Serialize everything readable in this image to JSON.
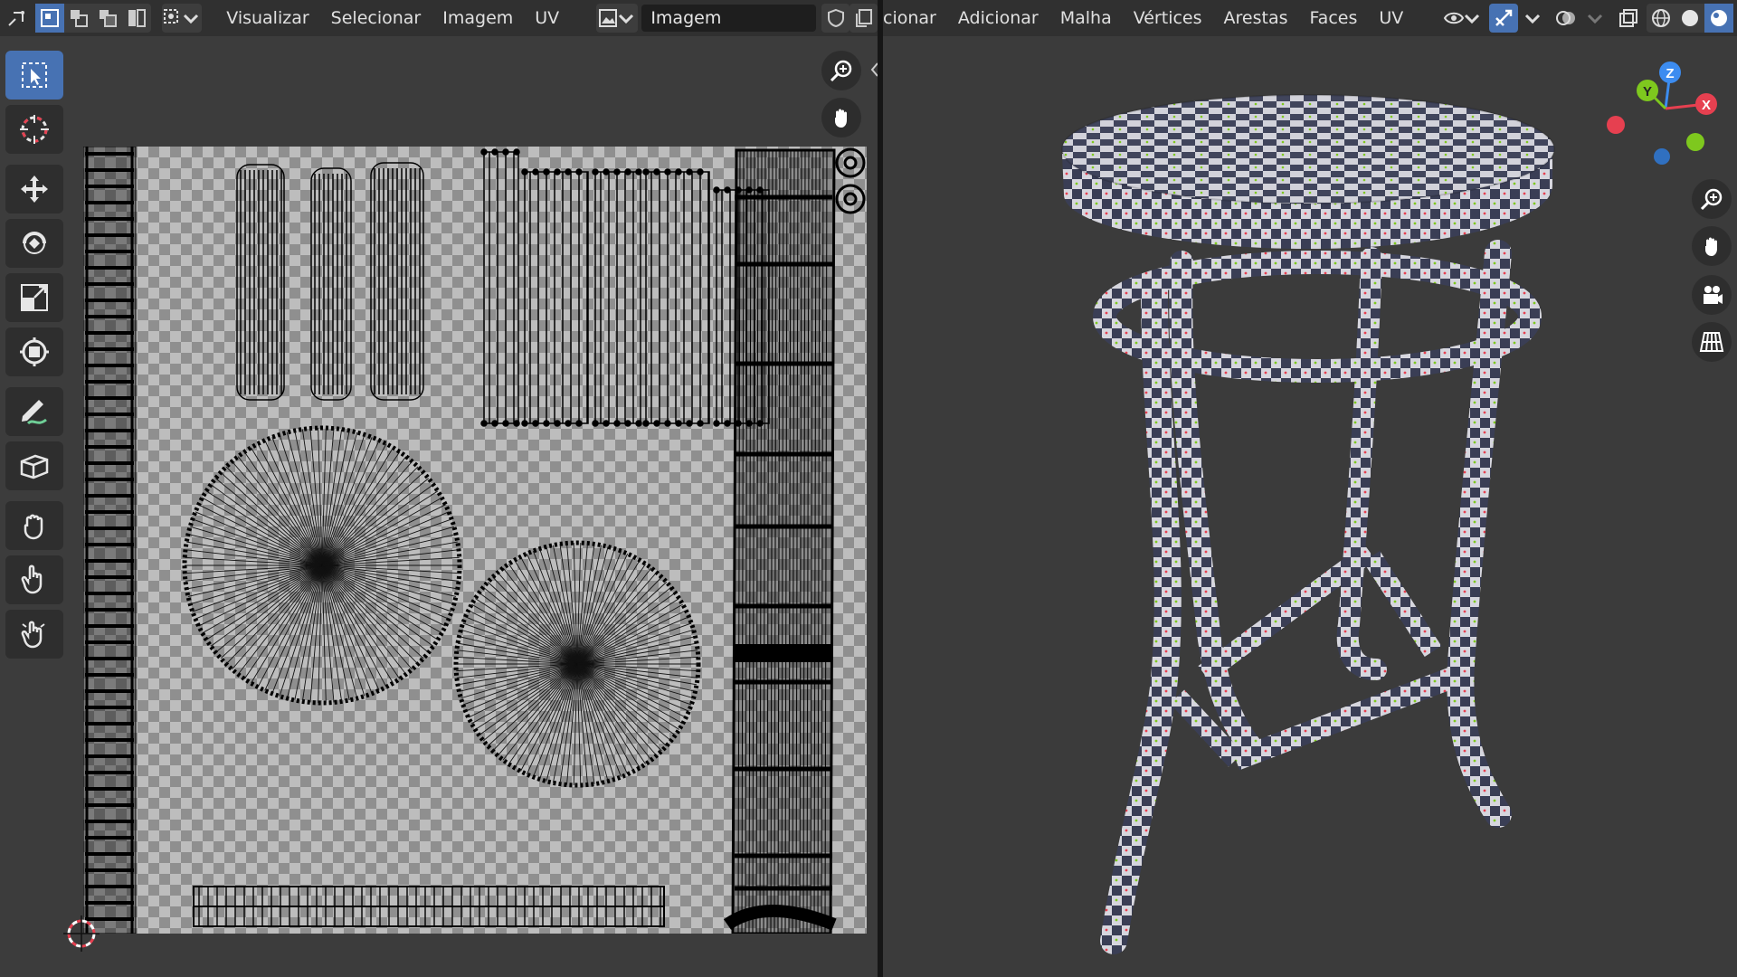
{
  "uv_editor": {
    "header": {
      "menus": [
        "Visualizar",
        "Selecionar",
        "Imagem",
        "UV"
      ],
      "image_name": "Imagem"
    },
    "toolbar": {
      "tools": [
        {
          "name": "select-box-tool",
          "icon": "select-box-icon",
          "active": true
        },
        {
          "name": "cursor-tool",
          "icon": "cursor-icon",
          "active": false
        },
        {
          "name": "move-tool",
          "icon": "move-icon",
          "active": false
        },
        {
          "name": "rotate-tool",
          "icon": "rotate-icon",
          "active": false
        },
        {
          "name": "scale-tool",
          "icon": "scale-icon",
          "active": false
        },
        {
          "name": "transform-tool",
          "icon": "transform-icon",
          "active": false
        },
        {
          "name": "annotate-tool",
          "icon": "annotate-icon",
          "active": false
        },
        {
          "name": "rip-tool",
          "icon": "rip-icon",
          "active": false
        },
        {
          "name": "grab-tool",
          "icon": "grab-icon",
          "active": false
        },
        {
          "name": "relax-tool",
          "icon": "relax-icon",
          "active": false
        },
        {
          "name": "pinch-tool",
          "icon": "pinch-icon",
          "active": false
        }
      ]
    },
    "nav_icons": [
      "zoom-icon",
      "pan-icon"
    ]
  },
  "viewport": {
    "header": {
      "menus": [
        "cionar",
        "Adicionar",
        "Malha",
        "Vértices",
        "Arestas",
        "Faces",
        "UV"
      ]
    },
    "gizmo_axes": {
      "x": "X",
      "y": "Y",
      "z": "Z"
    },
    "nav_icons": [
      "zoom-icon",
      "pan-icon",
      "camera-icon",
      "grid-icon"
    ]
  },
  "colors": {
    "accent": "#4772b3",
    "axis_x": "#e64050",
    "axis_y": "#7ec81e",
    "axis_z": "#3c8cf0"
  }
}
